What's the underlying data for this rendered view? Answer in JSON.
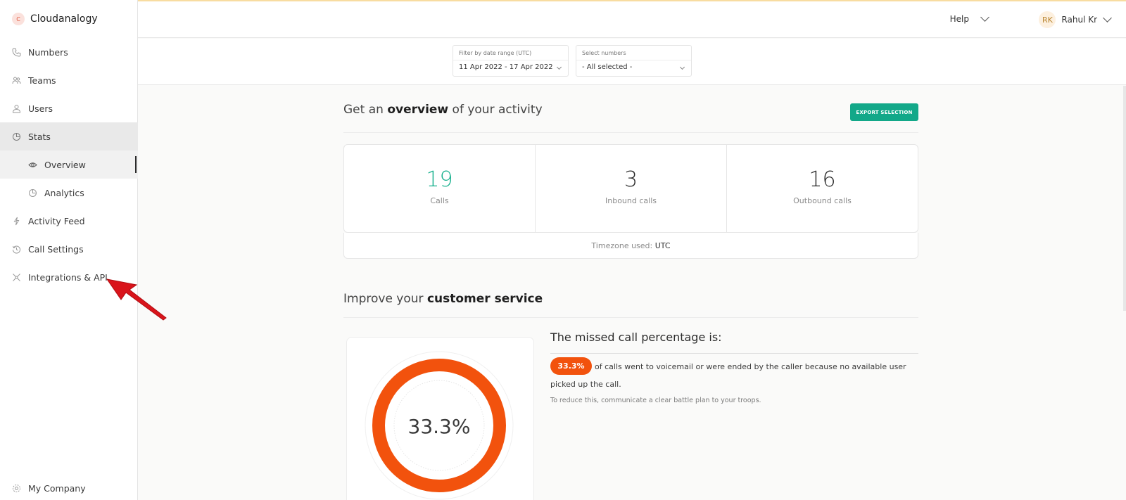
{
  "brand": {
    "logo_letter": "C",
    "name": "Cloudanalogy"
  },
  "sidebar": {
    "items": [
      {
        "label": "Numbers",
        "icon": "phone-icon"
      },
      {
        "label": "Teams",
        "icon": "team-icon"
      },
      {
        "label": "Users",
        "icon": "user-icon"
      },
      {
        "label": "Stats",
        "icon": "pie-chart-icon",
        "active": true
      },
      {
        "label": "Overview",
        "icon": "eye-icon",
        "sub": true,
        "selected": true
      },
      {
        "label": "Analytics",
        "icon": "pie-chart-icon",
        "sub": true
      },
      {
        "label": "Activity Feed",
        "icon": "bolt-icon"
      },
      {
        "label": "Call Settings",
        "icon": "history-icon"
      },
      {
        "label": "Integrations & API",
        "icon": "integrations-icon"
      }
    ],
    "footer_label": "My Company"
  },
  "header": {
    "help_label": "Help",
    "user_initials": "RK",
    "user_name": "Rahul Kr"
  },
  "filters": {
    "date": {
      "label": "Filter by date range (UTC)",
      "value": "11 Apr 2022 - 17 Apr 2022"
    },
    "numbers": {
      "label": "Select numbers",
      "value": "- All selected -"
    }
  },
  "overview": {
    "title_pre": "Get an ",
    "title_bold": "overview",
    "title_post": " of your activity",
    "export_label": "EXPORT SELECTION",
    "stats": [
      {
        "value": "19",
        "label": "Calls"
      },
      {
        "value": "3",
        "label": "Inbound calls"
      },
      {
        "value": "16",
        "label": "Outbound calls"
      }
    ],
    "timezone_label": "Timezone used: ",
    "timezone_value": "UTC"
  },
  "service": {
    "title_pre": "Improve your ",
    "title_bold": "customer service",
    "donut_label": "33.3%",
    "missed_percentage": 33.3,
    "missed_title": "The missed call percentage is:",
    "pill": "33.3%",
    "missed_text": "of calls went to voicemail or were ended by the caller because no available user picked up the call.",
    "hint": "To reduce this, communicate a clear battle plan to your troops."
  },
  "colors": {
    "accent_green": "#12a889",
    "stat_green": "#17b08d",
    "missed_orange": "#f2520d",
    "annotation_arrow": "#d9141b"
  }
}
